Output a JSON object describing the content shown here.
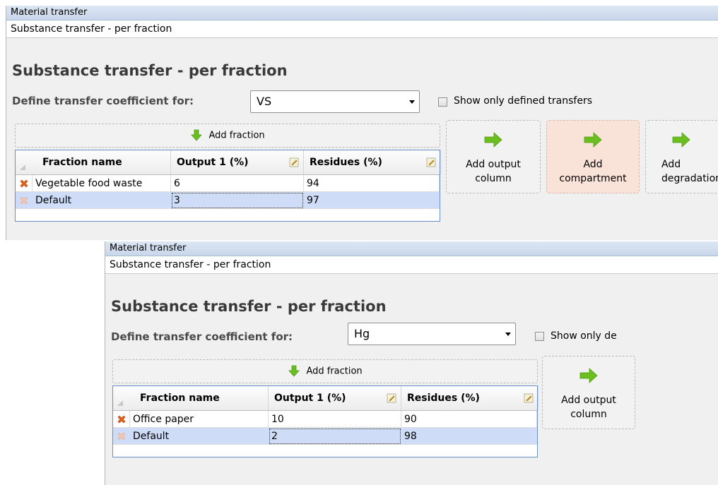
{
  "panel1": {
    "window_title": "Material transfer",
    "subtitle": "Substance transfer - per fraction",
    "heading": "Substance transfer - per fraction",
    "define_label": "Define transfer coefficient for:",
    "substance": "VS",
    "show_only_label": "Show only defined transfers",
    "add_fraction_label": "Add fraction",
    "columns": [
      "Fraction name",
      "Output 1 (%)",
      "Residues (%)"
    ],
    "rows": [
      {
        "name": "Vegetable food waste",
        "output1": "6",
        "residues": "94"
      },
      {
        "name": "Default",
        "output1": "3",
        "residues": "97"
      }
    ],
    "buttons": {
      "add_output": "Add output column",
      "add_compartment": "Add compartment",
      "add_degradation": "Add degradation"
    }
  },
  "panel2": {
    "window_title": "Material transfer",
    "subtitle": "Substance transfer - per fraction",
    "heading": "Substance transfer - per fraction",
    "define_label": "Define transfer coefficient for:",
    "substance": "Hg",
    "show_only_label": "Show only de",
    "add_fraction_label": "Add fraction",
    "columns": [
      "Fraction name",
      "Output 1 (%)",
      "Residues (%)"
    ],
    "rows": [
      {
        "name": "Office paper",
        "output1": "10",
        "residues": "90"
      },
      {
        "name": "Default",
        "output1": "2",
        "residues": "98"
      }
    ],
    "buttons": {
      "add_output": "Add output column"
    }
  },
  "colors": {
    "accent_green": "#6abf1f",
    "delete_orange": "#e5601c",
    "selection_blue": "#cfdcf7",
    "highlight_peach": "#f9e3d8"
  },
  "icons": [
    "add-fraction-arrow-icon",
    "delete-row-icon",
    "edit-pencil-icon",
    "green-right-arrow-icon",
    "dropdown-chevron-icon"
  ]
}
